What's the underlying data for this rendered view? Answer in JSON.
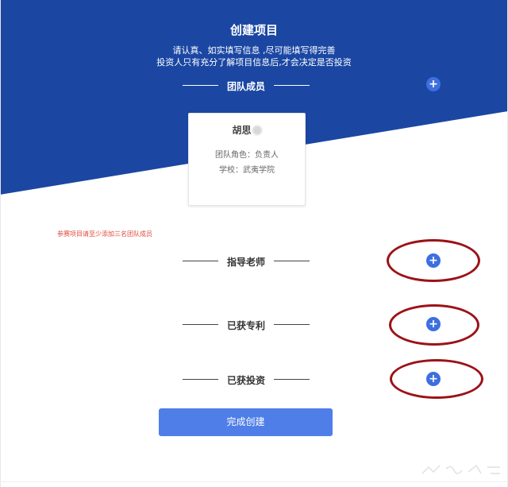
{
  "header": {
    "title": "创建项目",
    "subtitle_line1": "请认真、如实填写信息 ,尽可能填写得完善",
    "subtitle_line2": "投资人只有充分了解项目信息后,才会决定是否投资"
  },
  "sections": {
    "team": "团队成员",
    "mentor": "指导老师",
    "patent": "已获专利",
    "investment": "已获投资"
  },
  "member_card": {
    "name": "胡思",
    "role": "团队角色：负责人",
    "school": "学校：武夷学院"
  },
  "warning": "参赛项目请至少添加三名团队成员",
  "finish_button": "完成创建",
  "icons": {
    "add": "plus-icon"
  },
  "colors": {
    "header_blue": "#1b47a3",
    "button_blue": "#4f7ee8",
    "plus_blue": "#3d6fe0",
    "annotation_red": "#9c1218",
    "warning_red": "#e0483a"
  }
}
